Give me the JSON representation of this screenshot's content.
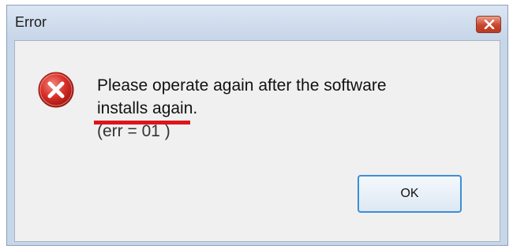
{
  "window": {
    "title": "Error"
  },
  "message": {
    "line1": "Please operate again after the software",
    "line2": "installs again.",
    "line3": "(err = 01 )"
  },
  "buttons": {
    "ok_label": "OK"
  },
  "icons": {
    "status": "error-icon",
    "close": "close-icon"
  },
  "colors": {
    "error_icon": "#d9302a",
    "redaction_line": "#e0141b",
    "close_button": "#c8462e",
    "focus_border": "#3c8fd6"
  }
}
